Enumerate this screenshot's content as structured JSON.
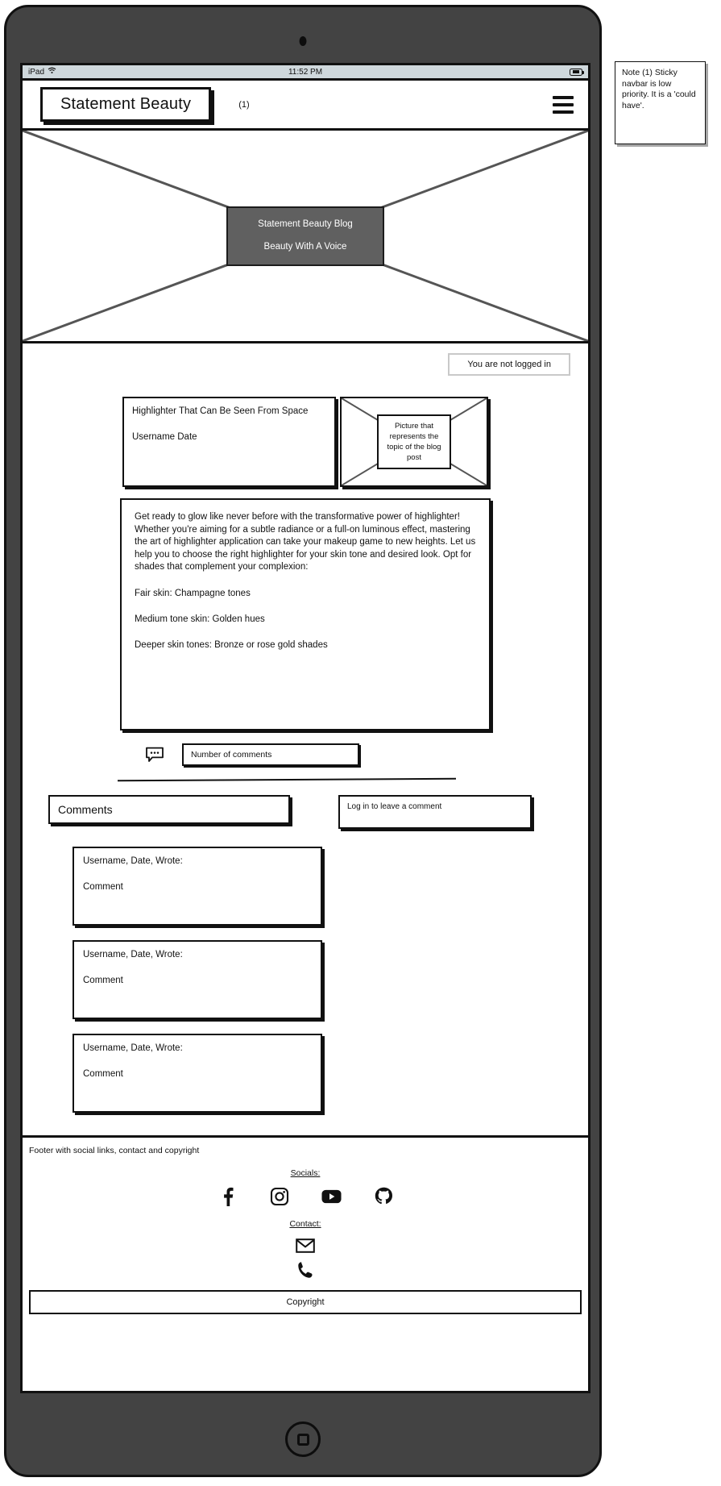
{
  "status_bar": {
    "device": "iPad",
    "wifi_icon": "wifi-icon",
    "time": "11:52 PM",
    "battery_icon": "battery-icon"
  },
  "navbar": {
    "logo": "Statement Beauty",
    "note_ref": "(1)",
    "menu_icon": "hamburger-menu-icon"
  },
  "hero": {
    "image_placeholder": "image-placeholder",
    "title": "Statement Beauty Blog",
    "subtitle": "Beauty With A Voice"
  },
  "login_status": {
    "text": "You are not logged in"
  },
  "post": {
    "title": "Highlighter That Can Be Seen From Space",
    "byline": "Username Date",
    "image_caption": "Picture that represents the topic of the blog post",
    "paragraph": "Get ready to glow like never before with the transformative power of highlighter! Whether you're aiming for a subtle radiance or a full-on luminous effect, mastering the art of highlighter application can take your makeup game to new heights. Let us help you to choose the right highlighter for your skin tone and desired look. Opt for shades that complement your complexion:",
    "shades": [
      "Fair skin: Champagne tones",
      "Medium tone skin: Golden hues",
      "Deeper skin tones: Bronze or rose gold shades"
    ],
    "comment_icon": "speech-bubble-icon",
    "comment_count_field": "Number of comments"
  },
  "comments_section": {
    "heading": "Comments",
    "login_prompt": "Log in to leave a comment",
    "comments": [
      {
        "author": "Username, Date, Wrote:",
        "text": "Comment"
      },
      {
        "author": "Username, Date, Wrote:",
        "text": "Comment"
      },
      {
        "author": "Username, Date, Wrote:",
        "text": "Comment"
      }
    ]
  },
  "footer": {
    "description": "Footer with social links, contact and copyright",
    "socials_label": "Socials:",
    "social_icons": [
      "facebook-icon",
      "instagram-icon",
      "youtube-icon",
      "github-icon"
    ],
    "contact_label": "Contact:",
    "contact_icons": [
      "email-icon",
      "phone-icon"
    ],
    "copyright": "Copyright"
  },
  "annotations": {
    "note_1": "Note (1) Sticky navbar is low priority. It is a 'could have'."
  },
  "colors": {
    "frame": "#434343",
    "outline": "#111111",
    "status_bar_bg": "#cfd8dc",
    "hero_overlay": "#606060",
    "page_bg": "#ffffff"
  }
}
